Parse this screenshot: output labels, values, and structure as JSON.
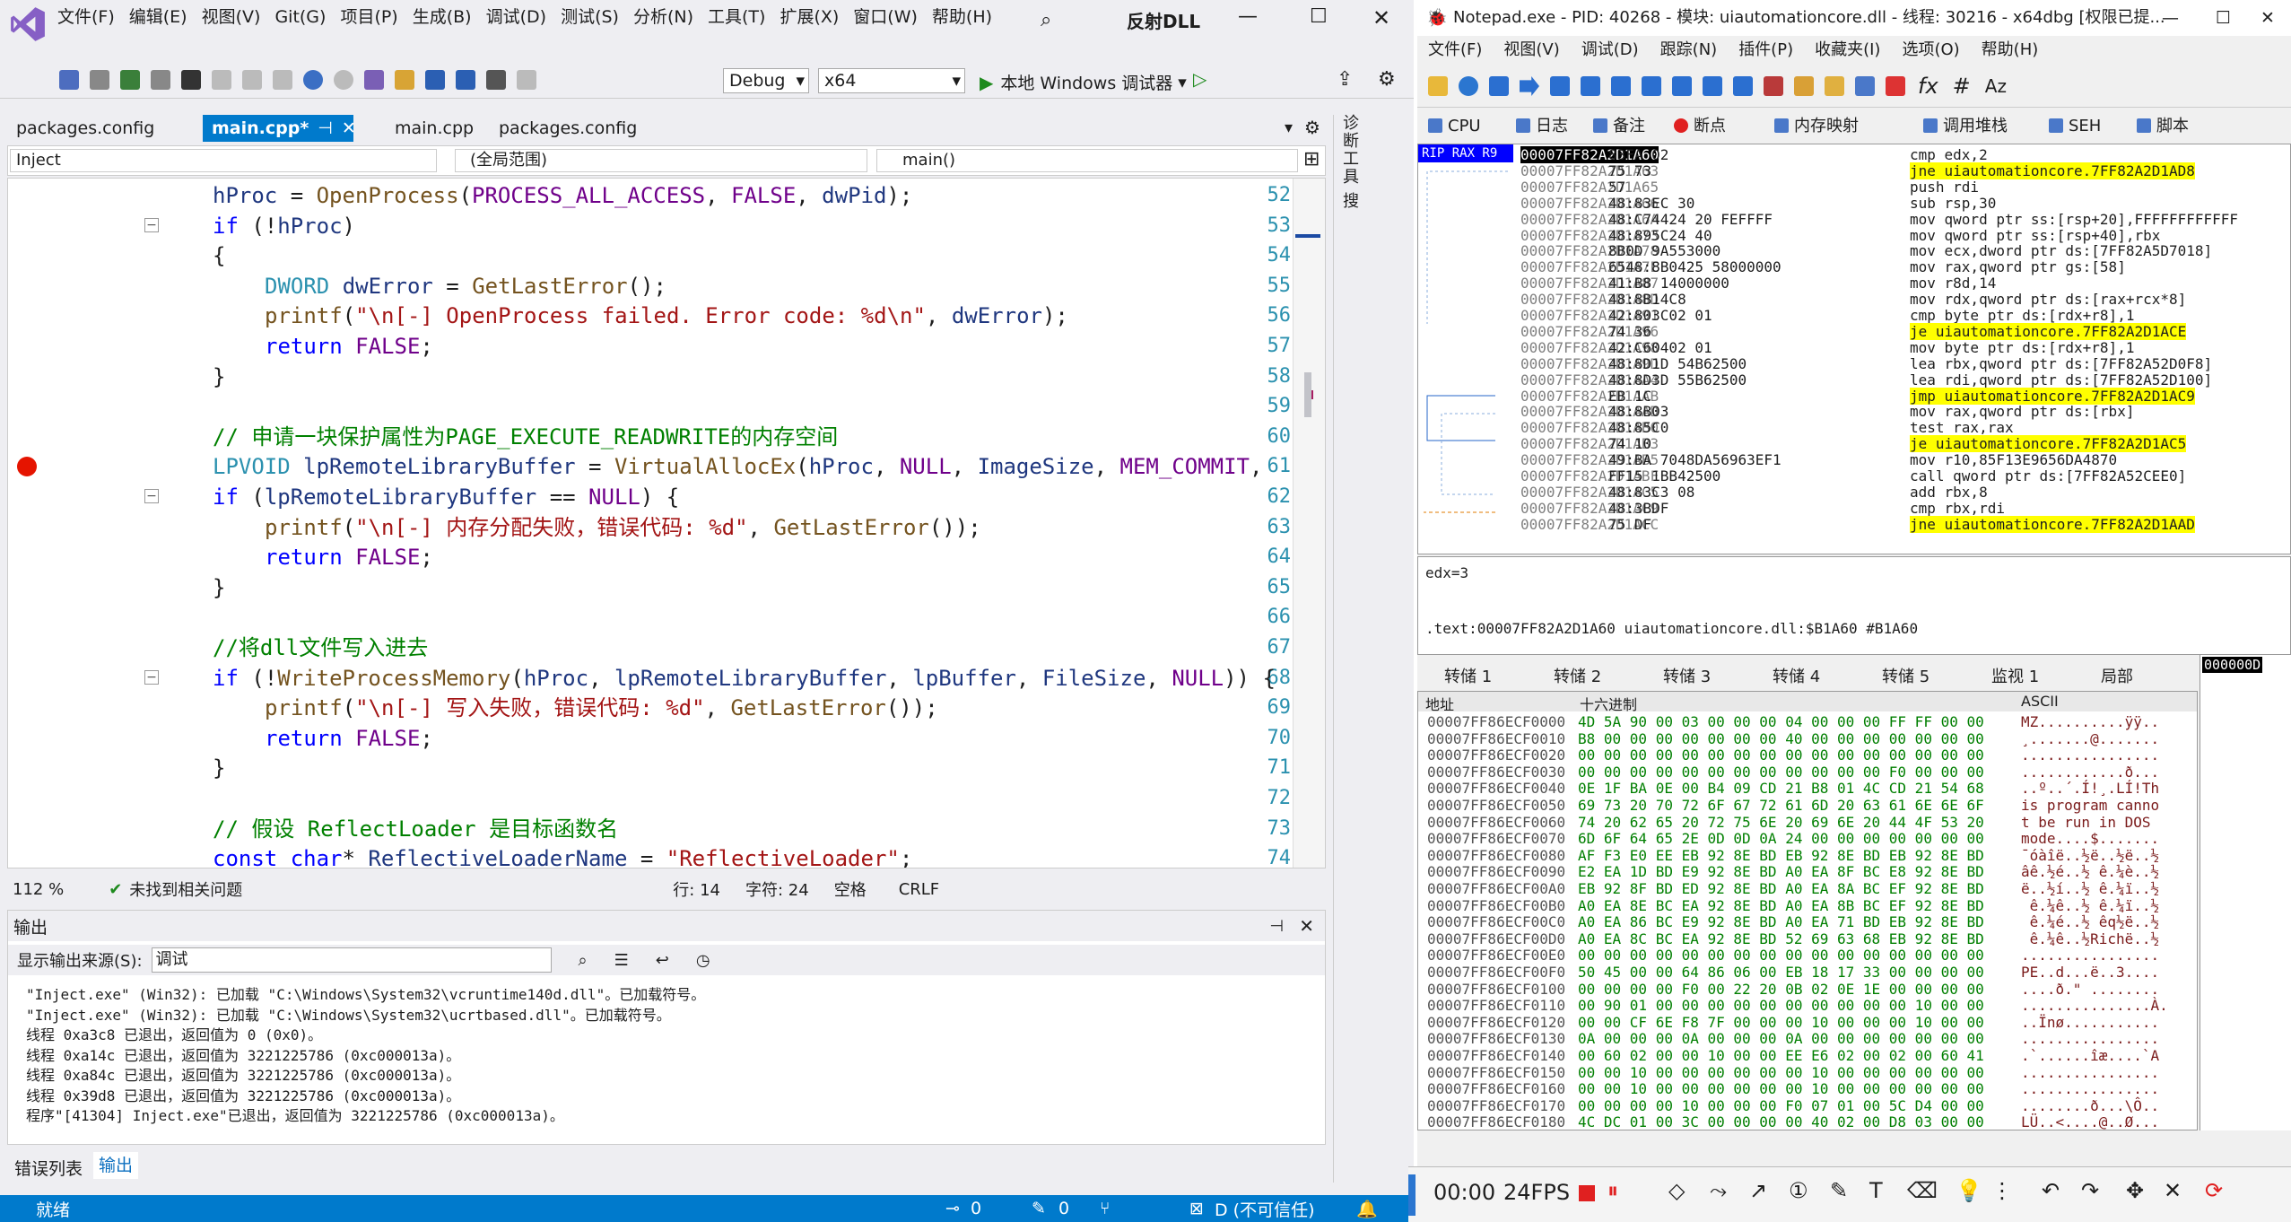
{
  "vs": {
    "menu": [
      "文件(F)",
      "编辑(E)",
      "视图(V)",
      "Git(G)",
      "项目(P)",
      "生成(B)",
      "调试(D)",
      "测试(S)",
      "分析(N)",
      "工具(T)",
      "扩展(X)",
      "窗口(W)",
      "帮助(H)"
    ],
    "solution_name": "反射DLL",
    "config": "Debug",
    "platform": "x64",
    "run_label": "本地 Windows 调试器",
    "tabs": [
      "packages.config",
      "main.cpp*",
      "main.cpp",
      "packages.config"
    ],
    "nav": {
      "project": "Inject",
      "scope": "(全局范围)",
      "member": "main()"
    },
    "code_lines": [
      {
        "n": "52",
        "text": "hProc = OpenProcess(PROCESS_ALL_ACCESS, FALSE, dwPid);",
        "indent": 1
      },
      {
        "n": "53",
        "text": "if (!hProc)",
        "indent": 1
      },
      {
        "n": "54",
        "text": "{",
        "indent": 1
      },
      {
        "n": "55",
        "text": "DWORD dwError = GetLastError();",
        "indent": 2
      },
      {
        "n": "56",
        "text": "printf(\"\\n[-] OpenProcess failed. Error code: %d\\n\", dwError);",
        "indent": 2
      },
      {
        "n": "57",
        "text": "return FALSE;",
        "indent": 2
      },
      {
        "n": "58",
        "text": "}",
        "indent": 1
      },
      {
        "n": "59",
        "text": "",
        "indent": 1
      },
      {
        "n": "60",
        "text": "// 申请一块保护属性为PAGE_EXECUTE_READWRITE的内存空间",
        "indent": 1
      },
      {
        "n": "61",
        "text": "LPVOID lpRemoteLibraryBuffer = VirtualAllocEx(hProc, NULL, ImageSize, MEM_COMMIT,",
        "indent": 1
      },
      {
        "n": "62",
        "text": "if (lpRemoteLibraryBuffer == NULL) {",
        "indent": 1
      },
      {
        "n": "63",
        "text": "printf(\"\\n[-] 内存分配失败，错误代码: %d\", GetLastError());",
        "indent": 2
      },
      {
        "n": "64",
        "text": "return FALSE;",
        "indent": 2
      },
      {
        "n": "65",
        "text": "}",
        "indent": 1
      },
      {
        "n": "66",
        "text": "",
        "indent": 1
      },
      {
        "n": "67",
        "text": "//将dll文件写入进去",
        "indent": 1
      },
      {
        "n": "68",
        "text": "if (!WriteProcessMemory(hProc, lpRemoteLibraryBuffer, lpBuffer, FileSize, NULL)) {",
        "indent": 1
      },
      {
        "n": "69",
        "text": "printf(\"\\n[-] 写入失败，错误代码: %d\", GetLastError());",
        "indent": 2
      },
      {
        "n": "70",
        "text": "return FALSE;",
        "indent": 2
      },
      {
        "n": "71",
        "text": "}",
        "indent": 1
      },
      {
        "n": "72",
        "text": "",
        "indent": 1
      },
      {
        "n": "73",
        "text": "// 假设 ReflectLoader 是目标函数名",
        "indent": 1
      },
      {
        "n": "74",
        "text": "const char* ReflectiveLoaderName = \"ReflectiveLoader\";",
        "indent": 1
      }
    ],
    "editor_status": {
      "zoom": "112 %",
      "issues": "未找到相关问题",
      "line": "行: 14",
      "col": "字符: 24",
      "space": "空格",
      "eol": "CRLF"
    },
    "output": {
      "title": "输出",
      "source_label": "显示输出来源(S):",
      "source": "调试",
      "lines": [
        "\"Inject.exe\" (Win32): 已加载 \"C:\\Windows\\System32\\vcruntime140d.dll\"。已加载符号。",
        "\"Inject.exe\" (Win32): 已加载 \"C:\\Windows\\System32\\ucrtbased.dll\"。已加载符号。",
        "线程 0xa3c8 已退出，返回值为 0 (0x0)。",
        "线程 0xa14c 已退出，返回值为 3221225786 (0xc000013a)。",
        "线程 0xa84c 已退出，返回值为 3221225786 (0xc000013a)。",
        "线程 0x39d8 已退出，返回值为 3221225786 (0xc000013a)。",
        "程序\"[41304] Inject.exe\"已退出，返回值为 3221225786 (0xc000013a)。"
      ]
    },
    "bottom_tabs": [
      "错误列表",
      "输出"
    ],
    "status": {
      "ready": "就绪",
      "errors": "0",
      "warnings": "0",
      "branch": "D (不可信任)"
    },
    "side_labels": [
      "诊断工具",
      "搜"
    ]
  },
  "xdbg": {
    "title": "Notepad.exe - PID: 40268 - 模块: uiautomationcore.dll - 线程: 30216 - x64dbg [权限已提...",
    "menu": [
      "文件(F)",
      "视图(V)",
      "调试(D)",
      "跟踪(N)",
      "插件(P)",
      "收藏夹(I)",
      "选项(O)",
      "帮助(H)"
    ],
    "tabs": [
      "CPU",
      "日志",
      "备注",
      "断点",
      "内存映射",
      "调用堆栈",
      "SEH",
      "脚本"
    ],
    "reg_label": "RIP RAX R9",
    "disasm": [
      {
        "addr": "00007FF82A2D1A60",
        "bytes": "83FA 02",
        "ins": "cmp edx,2",
        "hl": false
      },
      {
        "addr": "00007FF82A2D1A63",
        "bytes": "75 73",
        "ins": "jne uiautomationcore.7FF82A2D1AD8",
        "hl": true
      },
      {
        "addr": "00007FF82A2D1A65",
        "bytes": "57",
        "ins": "push rdi",
        "hl": false
      },
      {
        "addr": "00007FF82A2D1A66",
        "bytes": "48:83EC 30",
        "ins": "sub rsp,30",
        "hl": false
      },
      {
        "addr": "00007FF82A2D1A6A",
        "bytes": "48:C74424 20 FEFFFF",
        "ins": "mov qword ptr ss:[rsp+20],FFFFFFFFFFFF",
        "hl": false
      },
      {
        "addr": "00007FF82A2D1A73",
        "bytes": "48:895C24 40",
        "ins": "mov qword ptr ss:[rsp+40],rbx",
        "hl": false
      },
      {
        "addr": "00007FF82A2D1A78",
        "bytes": "8B0D 9A553000",
        "ins": "mov ecx,dword ptr ds:[7FF82A5D7018]",
        "hl": false
      },
      {
        "addr": "00007FF82A2D1A7E",
        "bytes": "6548:8B0425 58000000",
        "ins": "mov rax,qword ptr gs:[58]",
        "hl": false
      },
      {
        "addr": "00007FF82A2D1A87",
        "bytes": "41:B8 14000000",
        "ins": "mov r8d,14",
        "hl": false
      },
      {
        "addr": "00007FF82A2D1A8D",
        "bytes": "48:8B14C8",
        "ins": "mov rdx,qword ptr ds:[rax+rcx*8]",
        "hl": false
      },
      {
        "addr": "00007FF82A2D1A91",
        "bytes": "42:803C02 01",
        "ins": "cmp byte ptr ds:[rdx+r8],1",
        "hl": false
      },
      {
        "addr": "00007FF82A2D1A96",
        "bytes": "74 36",
        "ins": "je uiautomationcore.7FF82A2D1ACE",
        "hl": true
      },
      {
        "addr": "00007FF82A2D1A98",
        "bytes": "42:C60402 01",
        "ins": "mov byte ptr ds:[rdx+r8],1",
        "hl": false
      },
      {
        "addr": "00007FF82A2D1A9D",
        "bytes": "48:8D1D 54B62500",
        "ins": "lea rbx,qword ptr ds:[7FF82A52D0F8]",
        "hl": false
      },
      {
        "addr": "00007FF82A2D1AA4",
        "bytes": "48:8D3D 55B62500",
        "ins": "lea rdi,qword ptr ds:[7FF82A52D100]",
        "hl": false
      },
      {
        "addr": "00007FF82A2D1AAB",
        "bytes": "EB 1C",
        "ins": "jmp uiautomationcore.7FF82A2D1AC9",
        "hl": true
      },
      {
        "addr": "00007FF82A2D1AAD",
        "bytes": "48:8B03",
        "ins": "mov rax,qword ptr ds:[rbx]",
        "hl": false
      },
      {
        "addr": "00007FF82A2D1AB0",
        "bytes": "48:85C0",
        "ins": "test rax,rax",
        "hl": false
      },
      {
        "addr": "00007FF82A2D1AB3",
        "bytes": "74 10",
        "ins": "je uiautomationcore.7FF82A2D1AC5",
        "hl": true
      },
      {
        "addr": "00007FF82A2D1AB5",
        "bytes": "49:BA 7048DA56963EF1",
        "ins": "mov r10,85F13E9656DA4870",
        "hl": false
      },
      {
        "addr": "00007FF82A2D1ABF",
        "bytes": "FF15 1BB42500",
        "ins": "call qword ptr ds:[7FF82A52CEE0]",
        "hl": false
      },
      {
        "addr": "00007FF82A2D1AC5",
        "bytes": "48:83C3 08",
        "ins": "add rbx,8",
        "hl": false
      },
      {
        "addr": "00007FF82A2D1AC9",
        "bytes": "48:3BDF",
        "ins": "cmp rbx,rdi",
        "hl": false
      },
      {
        "addr": "00007FF82A2D1ACC",
        "bytes": "75 DF",
        "ins": "jne uiautomationcore.7FF82A2D1AAD",
        "hl": true
      }
    ],
    "info_lines": [
      "edx=3",
      "",
      ".text:00007FF82A2D1A60 uiautomationcore.dll:$B1A60 #B1A60"
    ],
    "dump_tabs": [
      "转储 1",
      "转储 2",
      "转储 3",
      "转储 4",
      "转储 5",
      "监视 1",
      "局部"
    ],
    "dump_headers": {
      "addr": "地址",
      "hex": "十六进制",
      "ascii": "ASCII"
    },
    "dump_rows": [
      {
        "addr": "00007FF86ECF0000",
        "hex": "4D 5A 90 00 03 00 00 00 04 00 00 00 FF FF 00 00",
        "ascii": "MZ..........ÿÿ.."
      },
      {
        "addr": "00007FF86ECF0010",
        "hex": "B8 00 00 00 00 00 00 00 40 00 00 00 00 00 00 00",
        "ascii": "¸.......@......."
      },
      {
        "addr": "00007FF86ECF0020",
        "hex": "00 00 00 00 00 00 00 00 00 00 00 00 00 00 00 00",
        "ascii": "................"
      },
      {
        "addr": "00007FF86ECF0030",
        "hex": "00 00 00 00 00 00 00 00 00 00 00 00 F0 00 00 00",
        "ascii": "............ð..."
      },
      {
        "addr": "00007FF86ECF0040",
        "hex": "0E 1F BA 0E 00 B4 09 CD 21 B8 01 4C CD 21 54 68",
        "ascii": "..º..´.Í!¸.LÍ!Th"
      },
      {
        "addr": "00007FF86ECF0050",
        "hex": "69 73 20 70 72 6F 67 72 61 6D 20 63 61 6E 6E 6F",
        "ascii": "is program canno"
      },
      {
        "addr": "00007FF86ECF0060",
        "hex": "74 20 62 65 20 72 75 6E 20 69 6E 20 44 4F 53 20",
        "ascii": "t be run in DOS "
      },
      {
        "addr": "00007FF86ECF0070",
        "hex": "6D 6F 64 65 2E 0D 0D 0A 24 00 00 00 00 00 00 00",
        "ascii": "mode....$......."
      },
      {
        "addr": "00007FF86ECF0080",
        "hex": "AF F3 E0 EE EB 92 8E BD EB 92 8E BD EB 92 8E BD",
        "ascii": "¯óàîë..½ë..½ë..½"
      },
      {
        "addr": "00007FF86ECF0090",
        "hex": "E2 EA 1D BD E9 92 8E BD A0 EA 8F BC E8 92 8E BD",
        "ascii": "âê.½é..½ ê.¼è..½"
      },
      {
        "addr": "00007FF86ECF00A0",
        "hex": "EB 92 8F BD ED 92 8E BD A0 EA 8A BC EF 92 8E BD",
        "ascii": "ë..½í..½ ê.¼ï..½"
      },
      {
        "addr": "00007FF86ECF00B0",
        "hex": "A0 EA 8E BC EA 92 8E BD A0 EA 8B BC EF 92 8E BD",
        "ascii": " ê.¼ê..½ ê.¼ï..½"
      },
      {
        "addr": "00007FF86ECF00C0",
        "hex": "A0 EA 86 BC E9 92 8E BD A0 EA 71 BD EB 92 8E BD",
        "ascii": " ê.¼é..½ êq½ë..½"
      },
      {
        "addr": "00007FF86ECF00D0",
        "hex": "A0 EA 8C BC EA 92 8E BD 52 69 63 68 EB 92 8E BD",
        "ascii": " ê.¼ê..½Richë..½"
      },
      {
        "addr": "00007FF86ECF00E0",
        "hex": "00 00 00 00 00 00 00 00 00 00 00 00 00 00 00 00",
        "ascii": "................"
      },
      {
        "addr": "00007FF86ECF00F0",
        "hex": "50 45 00 00 64 86 06 00 EB 18 17 33 00 00 00 00",
        "ascii": "PE..d...ë..3...."
      },
      {
        "addr": "00007FF86ECF0100",
        "hex": "00 00 00 00 F0 00 22 20 0B 02 0E 1E 00 00 00 00",
        "ascii": "....ð.\" ........"
      },
      {
        "addr": "00007FF86ECF0110",
        "hex": "00 90 01 00 00 00 00 00 00 00 00 00 00 10 00 00",
        "ascii": "...............À."
      },
      {
        "addr": "00007FF86ECF0120",
        "hex": "00 00 CF 6E F8 7F 00 00 00 10 00 00 00 10 00 00",
        "ascii": "..Ïnø..........."
      },
      {
        "addr": "00007FF86ECF0130",
        "hex": "0A 00 00 00 0A 00 00 00 0A 00 00 00 00 00 00 00",
        "ascii": "................"
      },
      {
        "addr": "00007FF86ECF0140",
        "hex": "00 60 02 00 00 10 00 00 EE E6 02 00 02 00 60 41",
        "ascii": ".`......îæ....`A"
      },
      {
        "addr": "00007FF86ECF0150",
        "hex": "00 00 10 00 00 00 00 00 00 10 00 00 00 00 00 00",
        "ascii": "................"
      },
      {
        "addr": "00007FF86ECF0160",
        "hex": "00 00 10 00 00 00 00 00 00 10 00 00 00 00 00 00",
        "ascii": "................"
      },
      {
        "addr": "00007FF86ECF0170",
        "hex": "00 00 00 00 10 00 00 00 F0 07 01 00 5C D4 00 00",
        "ascii": "........ð...\\Ô.."
      },
      {
        "addr": "00007FF86ECF0180",
        "hex": "4C DC 01 00 3C 00 00 00 00 40 02 00 D8 03 00 00",
        "ascii": "LÜ..<....@..Ø..."
      }
    ],
    "stack_top": "000000D",
    "recorder": {
      "time": "00:00",
      "fps": "24FPS"
    }
  }
}
